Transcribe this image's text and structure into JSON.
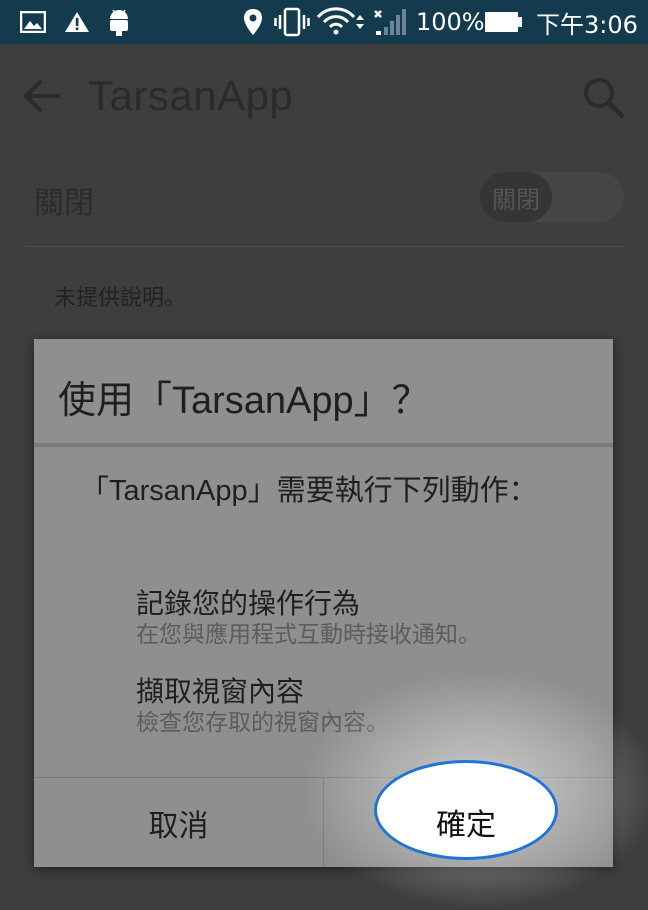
{
  "status_bar": {
    "battery_percent": "100%",
    "time": "下午3:06",
    "icons": [
      "gallery-icon",
      "warning-icon",
      "android-icon",
      "location-icon",
      "vibrate-icon",
      "wifi-icon",
      "signal-icon",
      "battery-icon"
    ]
  },
  "app_bar": {
    "title": "TarsanApp",
    "icons": [
      "back-arrow-icon",
      "search-icon"
    ]
  },
  "switch_row": {
    "label": "關閉",
    "toggle_text": "關閉",
    "on": false
  },
  "description": "未提供說明。",
  "dialog": {
    "title": "使用「TarsanApp」？",
    "message": "「TarsanApp」需要執行下列動作：",
    "permissions": [
      {
        "title": "記錄您的操作行為",
        "desc": "在您與應用程式互動時接收通知。"
      },
      {
        "title": "擷取視窗內容",
        "desc": "檢查您存取的視窗內容。"
      }
    ],
    "cancel_label": "取消",
    "ok_label": "確定"
  },
  "colors": {
    "status_bar_bg": "#143a4e",
    "scrim_bg": "#3e3e3e",
    "dialog_bg": "#8f8f8f",
    "highlight_ring": "#1f74d8"
  }
}
